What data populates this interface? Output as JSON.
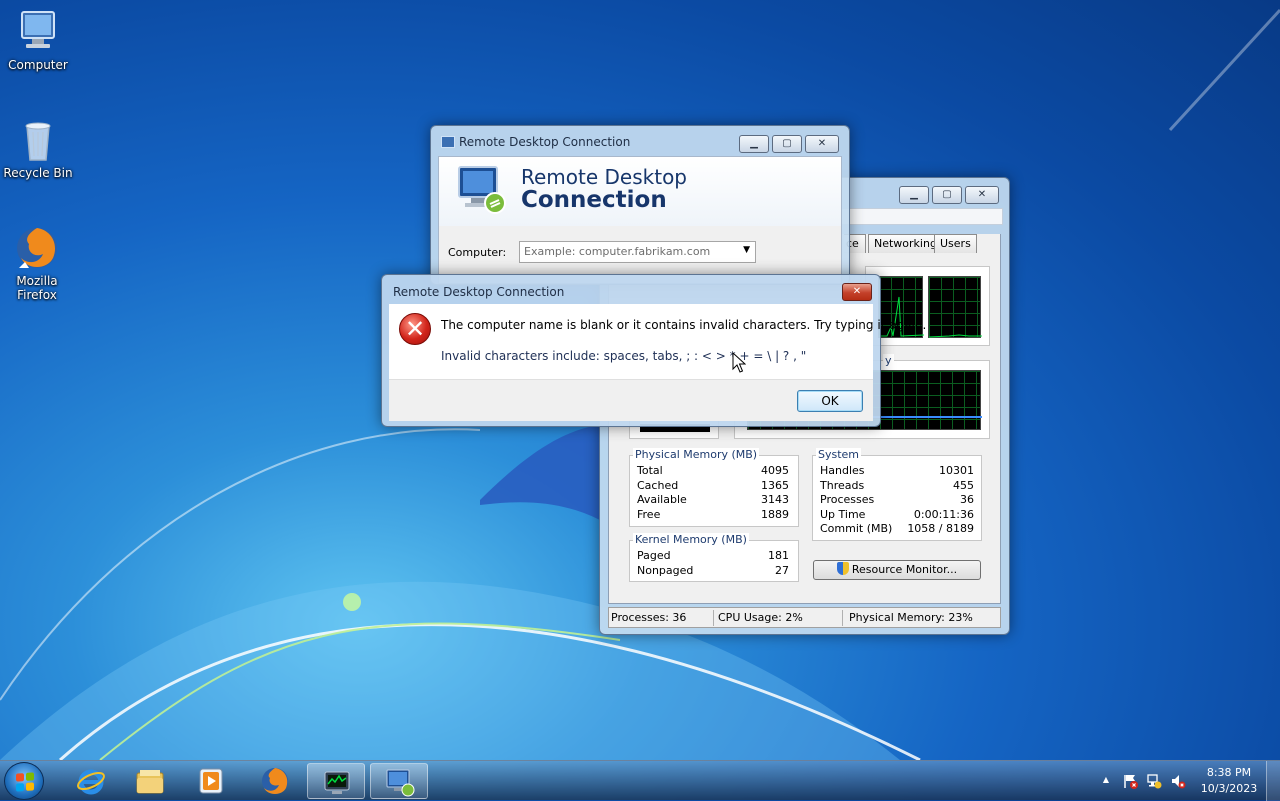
{
  "desktop": {
    "icons": [
      {
        "label": "Computer"
      },
      {
        "label": "Recycle Bin"
      },
      {
        "label": "Mozilla Firefox"
      }
    ]
  },
  "task_manager": {
    "tabs": [
      "ce",
      "Networking",
      "Users"
    ],
    "partial_label_memory": "y",
    "physical_memory": {
      "title": "Physical Memory (MB)",
      "rows": [
        {
          "label": "Total",
          "value": "4095"
        },
        {
          "label": "Cached",
          "value": "1365"
        },
        {
          "label": "Available",
          "value": "3143"
        },
        {
          "label": "Free",
          "value": "1889"
        }
      ]
    },
    "kernel_memory": {
      "title": "Kernel Memory (MB)",
      "rows": [
        {
          "label": "Paged",
          "value": "181"
        },
        {
          "label": "Nonpaged",
          "value": "27"
        }
      ]
    },
    "system": {
      "title": "System",
      "rows": [
        {
          "label": "Handles",
          "value": "10301"
        },
        {
          "label": "Threads",
          "value": "455"
        },
        {
          "label": "Processes",
          "value": "36"
        },
        {
          "label": "Up Time",
          "value": "0:00:11:36"
        },
        {
          "label": "Commit (MB)",
          "value": "1058 / 8189"
        }
      ]
    },
    "resource_monitor_button": "Resource Monitor...",
    "status": {
      "processes": "Processes: 36",
      "cpu": "CPU Usage: 2%",
      "memory": "Physical Memory: 23%"
    }
  },
  "rdc": {
    "window_title": "Remote Desktop Connection",
    "banner_line1": "Remote Desktop",
    "banner_line2": "Connection",
    "computer_label": "Computer:",
    "computer_placeholder": "Example: computer.fabrikam.com"
  },
  "error_dialog": {
    "title": "Remote Desktop Connection",
    "message": "The computer name is blank or it contains invalid characters. Try typing it again.",
    "detail": "Invalid characters include: spaces, tabs, ; : < > * + = \\ | ? , \"",
    "ok_label": "OK"
  },
  "taskbar": {
    "clock_time": "8:38 PM",
    "clock_date": "10/3/2023",
    "tray_arrow": "▲"
  },
  "colors": {
    "title_text": "#1e2d44",
    "banner_text": "#17366b",
    "close_red": "#c4412a",
    "graph_green": "#00e040"
  }
}
